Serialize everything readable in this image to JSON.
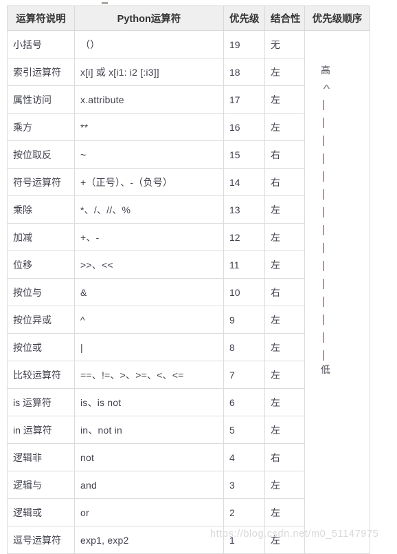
{
  "table": {
    "headers": [
      "运算符说明",
      "Python运算符",
      "优先级",
      "结合性",
      "优先级顺序"
    ],
    "rows": [
      {
        "desc": "小括号",
        "ops": "（）",
        "prec": "19",
        "assoc": "无"
      },
      {
        "desc": "索引运算符",
        "ops": "x[i] 或 x[i1: i2 [:i3]]",
        "prec": "18",
        "assoc": "左"
      },
      {
        "desc": "属性访问",
        "ops": "x.attribute",
        "prec": "17",
        "assoc": "左"
      },
      {
        "desc": "乘方",
        "ops": "**",
        "prec": "16",
        "assoc": "左"
      },
      {
        "desc": "按位取反",
        "ops": "~",
        "prec": "15",
        "assoc": "右"
      },
      {
        "desc": "符号运算符",
        "ops": "+（正号）、-（负号）",
        "prec": "14",
        "assoc": "右"
      },
      {
        "desc": "乘除",
        "ops": "*、/、//、%",
        "prec": "13",
        "assoc": "左"
      },
      {
        "desc": "加减",
        "ops": "+、-",
        "prec": "12",
        "assoc": "左"
      },
      {
        "desc": "位移",
        "ops": ">>、<<",
        "prec": "11",
        "assoc": "左"
      },
      {
        "desc": "按位与",
        "ops": "&",
        "prec": "10",
        "assoc": "右"
      },
      {
        "desc": "按位异或",
        "ops": "^",
        "prec": "9",
        "assoc": "左"
      },
      {
        "desc": "按位或",
        "ops": "|",
        "prec": "8",
        "assoc": "左"
      },
      {
        "desc": "比较运算符",
        "ops": "==、!=、>、>=、<、<=",
        "prec": "7",
        "assoc": "左"
      },
      {
        "desc": "is 运算符",
        "ops": "is、is not",
        "prec": "6",
        "assoc": "左"
      },
      {
        "desc": "in 运算符",
        "ops": "in、not in",
        "prec": "5",
        "assoc": "左"
      },
      {
        "desc": "逻辑非",
        "ops": "not",
        "prec": "4",
        "assoc": "右"
      },
      {
        "desc": "逻辑与",
        "ops": "and",
        "prec": "3",
        "assoc": "左"
      },
      {
        "desc": "逻辑或",
        "ops": "or",
        "prec": "2",
        "assoc": "左"
      },
      {
        "desc": "逗号运算符",
        "ops": "exp1, exp2",
        "prec": "1",
        "assoc": "左"
      }
    ],
    "priority_order": {
      "high_label": "高",
      "low_label": "低",
      "arrow_head": "∧",
      "dash_count": 15
    }
  },
  "watermark": {
    "text": "https://blog.csdn.net/m0_51147975"
  },
  "colors": {
    "header_bg": "#efefef",
    "border": "#dcdcdc",
    "text": "#41424d",
    "watermark": "#d8d8d8"
  }
}
